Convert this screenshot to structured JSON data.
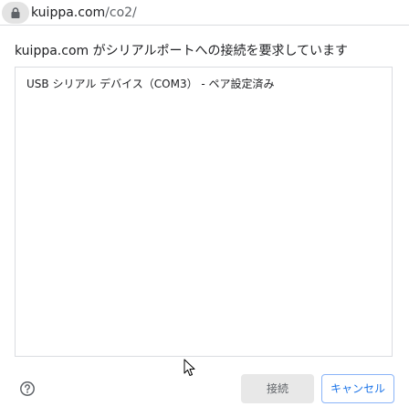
{
  "address_bar": {
    "host": "kuippa.com",
    "path": "/co2/"
  },
  "dialog": {
    "title": "kuippa.com がシリアルポートへの接続を要求しています",
    "devices": [
      {
        "label": "USB シリアル デバイス（COM3） - ペア設定済み"
      }
    ],
    "connect_label": "接続",
    "cancel_label": "キャンセル",
    "help_icon": "help-circle-icon"
  },
  "colors": {
    "accent": "#1a73e8",
    "border": "#dadce0",
    "disabled_button_bg": "#e8e8e8"
  }
}
